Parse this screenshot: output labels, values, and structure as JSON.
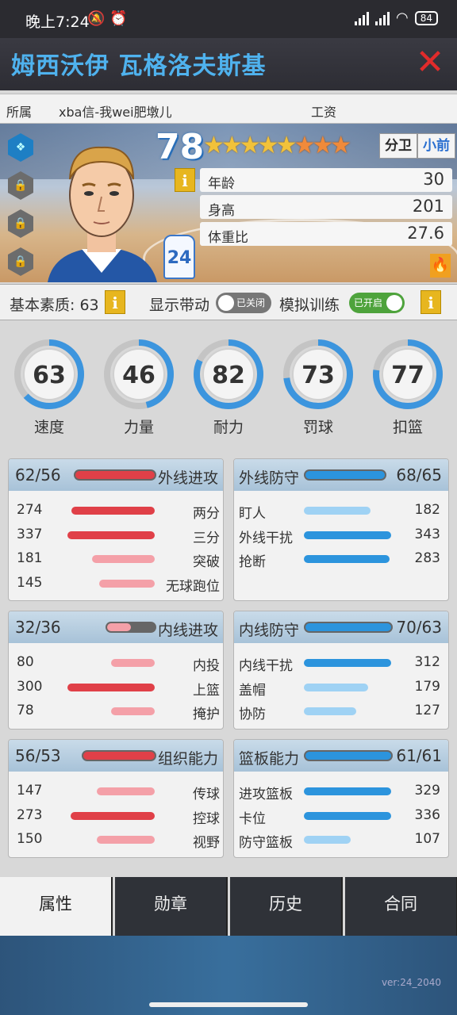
{
  "status_bar": {
    "time": "晚上7:24",
    "battery": "84",
    "left_icons": [
      "mute-icon",
      "alarm-icon"
    ],
    "right_icons": [
      "hd-signal-icon",
      "hd-signal-icon",
      "wifi-icon",
      "battery-icon"
    ]
  },
  "header": {
    "title": "姆西沃伊 瓦格洛夫斯基",
    "close_icon": "close-icon"
  },
  "info": {
    "team_label": "所属",
    "team_value": "xba信-我wei肥墩儿",
    "salary_label": "工资"
  },
  "player": {
    "rating": "78",
    "stars_gold": "★★★★★",
    "stars_orange": "★★★",
    "position_primary": "分卫",
    "position_secondary": "小前",
    "jersey": "24",
    "stats": [
      {
        "label": "年龄",
        "value": "30"
      },
      {
        "label": "身高",
        "value": "201"
      },
      {
        "label": "体重比",
        "value": "27.6"
      }
    ]
  },
  "basic": {
    "quality_label": "基本素质: 63",
    "show_dribble_label": "显示带动",
    "show_dribble_state": "已关闭",
    "sim_training_label": "模拟训练",
    "sim_training_state": "已开启"
  },
  "gauges": [
    {
      "label": "速度",
      "value": "63",
      "fraction": 0.63
    },
    {
      "label": "力量",
      "value": "46",
      "fraction": 0.46
    },
    {
      "label": "耐力",
      "value": "82",
      "fraction": 0.82
    },
    {
      "label": "罚球",
      "value": "73",
      "fraction": 0.73
    },
    {
      "label": "扣篮",
      "value": "77",
      "fraction": 0.77
    }
  ],
  "panels": {
    "outside_offense": {
      "name": "外线进攻",
      "score": "62/56",
      "fill": 1.0,
      "rows": [
        {
          "label": "两分",
          "value": "274",
          "fill": 0.95,
          "tone": "red"
        },
        {
          "label": "三分",
          "value": "337",
          "fill": 1.0,
          "tone": "red"
        },
        {
          "label": "突破",
          "value": "181",
          "fill": 0.72,
          "tone": "pink"
        },
        {
          "label": "无球跑位",
          "value": "145",
          "fill": 0.64,
          "tone": "pink"
        }
      ]
    },
    "outside_defense": {
      "name": "外线防守",
      "score": "68/65",
      "fill": 1.0,
      "rows": [
        {
          "label": "盯人",
          "value": "182",
          "fill": 0.76,
          "tone": "lblue"
        },
        {
          "label": "外线干扰",
          "value": "343",
          "fill": 1.0,
          "tone": "blue"
        },
        {
          "label": "抢断",
          "value": "283",
          "fill": 0.98,
          "tone": "blue"
        }
      ]
    },
    "inside_offense": {
      "name": "内线进攻",
      "score": "32/36",
      "fill": 0.5,
      "rows": [
        {
          "label": "内投",
          "value": "80",
          "fill": 0.5,
          "tone": "pink"
        },
        {
          "label": "上篮",
          "value": "300",
          "fill": 1.0,
          "tone": "red"
        },
        {
          "label": "掩护",
          "value": "78",
          "fill": 0.5,
          "tone": "pink"
        }
      ]
    },
    "inside_defense": {
      "name": "内线防守",
      "score": "70/63",
      "fill": 1.0,
      "rows": [
        {
          "label": "内线干扰",
          "value": "312",
          "fill": 1.0,
          "tone": "blue"
        },
        {
          "label": "盖帽",
          "value": "179",
          "fill": 0.74,
          "tone": "lblue"
        },
        {
          "label": "协防",
          "value": "127",
          "fill": 0.6,
          "tone": "lblue"
        }
      ]
    },
    "playmaking": {
      "name": "组织能力",
      "score": "56/53",
      "fill": 1.0,
      "rows": [
        {
          "label": "传球",
          "value": "147",
          "fill": 0.66,
          "tone": "pink"
        },
        {
          "label": "控球",
          "value": "273",
          "fill": 0.96,
          "tone": "red"
        },
        {
          "label": "视野",
          "value": "150",
          "fill": 0.66,
          "tone": "pink"
        }
      ]
    },
    "rebounding": {
      "name": "篮板能力",
      "score": "61/61",
      "fill": 1.0,
      "rows": [
        {
          "label": "进攻篮板",
          "value": "329",
          "fill": 1.0,
          "tone": "blue"
        },
        {
          "label": "卡位",
          "value": "336",
          "fill": 1.0,
          "tone": "blue"
        },
        {
          "label": "防守篮板",
          "value": "107",
          "fill": 0.54,
          "tone": "lblue"
        }
      ]
    }
  },
  "tabs": [
    "属性",
    "勋章",
    "历史",
    "合同"
  ],
  "version": "ver:24_2040"
}
